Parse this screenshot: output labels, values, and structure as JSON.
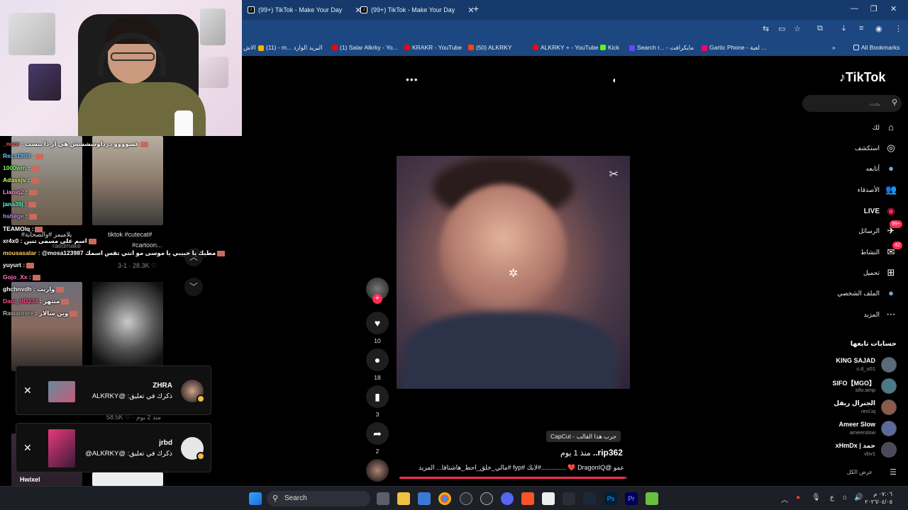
{
  "browser": {
    "tabs": [
      {
        "label": "(99+) TikTok - Make Your Day"
      },
      {
        "label": "(99+) TikTok - Make Your Day"
      }
    ],
    "bookmarks": [
      {
        "label": "الاش",
        "color": "#d9d9d9"
      },
      {
        "label": "(11) - m... البريد الوارد",
        "color": "#f4b400"
      },
      {
        "label": "(1) Salar Alkrky - Yo...",
        "color": "#ff0000"
      },
      {
        "label": "KRAKR - YouTube",
        "color": "#ff0000"
      },
      {
        "label": "(50) ALKRKY",
        "color": "#ff4500"
      },
      {
        "label": "ALKRKY + - YouTube",
        "color": "#ff0000"
      },
      {
        "label": "Kick",
        "color": "#53fc18"
      },
      {
        "label": "Search r... - مايكرافت",
        "color": "#6e44ff"
      },
      {
        "label": "Gartic Phone - لعبة ...",
        "color": "#f06"
      }
    ],
    "all_bookmarks": "All Bookmarks"
  },
  "left_panel": {
    "thumbs": [
      {
        "caption": "#يلاميمز #والصحابة",
        "stat": "raedmake"
      },
      {
        "caption": "tiktok #cutecat#",
        "caption2": "#cartoon...",
        "stat": "3-1 · 28.3K ♡"
      },
      {
        "caption": "",
        "stat": "58.5K ♡ · منذ 2 يوم"
      }
    ],
    "chat": [
      {
        "user": "_noor",
        "text": ": عسوووو درداوشششش هي از ذا بيست",
        "color": "#ff4f4f"
      },
      {
        "user": "Reza1999",
        "text": ":",
        "color": "#6ec6ff"
      },
      {
        "user": "1000wm",
        "text": ":",
        "color": "#7cff6e"
      },
      {
        "user": "Adassjv",
        "text": ":",
        "color": "#d0ff5a"
      },
      {
        "user": "Lianiq2",
        "text": ":",
        "color": "#ff8ad8"
      },
      {
        "user": "jana39j",
        "text": ":",
        "color": "#5affd4"
      },
      {
        "user": "hshege",
        "text": ":",
        "color": "#b98aff"
      },
      {
        "user": "TEAMOlq",
        "text": ":",
        "color": "#ffffff"
      },
      {
        "user": "xr4x0",
        "text": ": اسم على مسمى تنين",
        "color": "#ffffff"
      },
      {
        "user": "mousasalar",
        "text": ": @mosa123987 مطيك يا حبيبي يا موسى مو انتي تقس اسمك",
        "color": "#ffd15a"
      },
      {
        "user": "yuyurt",
        "text": ":",
        "color": "#ffffff"
      },
      {
        "user": "Gojo_Xx",
        "text": ":",
        "color": "#ff6ec7"
      },
      {
        "user": "ghchnvdh",
        "text": ": واربت",
        "color": "#ffffff"
      },
      {
        "user": "Dani_HD234",
        "text": ": منتهر",
        "color": "#ff4f8a"
      },
      {
        "user": "Rawanrere",
        "text": ": وين سالار",
        "color": "#aaaaaa"
      }
    ],
    "notifications": [
      {
        "user": "ZHRA",
        "message": "ذكرك في تعليق: @ALKRKY"
      },
      {
        "user": "jrbd",
        "message": "ذكرك في تعليق: @ALKRKY@"
      }
    ],
    "bottom_label": "Hwixel"
  },
  "video": {
    "likes": "10",
    "comments": "18",
    "saves": "3",
    "shares": "2",
    "template_pill": "CapCut - جرب هذا القالب",
    "author_name": "rip362..",
    "author_time": "منذ 1 يوم",
    "caption": "عمو @DragonIQ ❤️ ..............#لايك #fyp #مالي_خلق_احط_هاشتاقا... المزيد",
    "progress": 0.99
  },
  "tiktok": {
    "logo": "TikTok",
    "search_placeholder": "بحث",
    "nav": [
      {
        "label": "لك",
        "icon": "home-icon",
        "glyph": "⌂"
      },
      {
        "label": "استكشف",
        "icon": "compass-icon",
        "glyph": "◎"
      },
      {
        "label": "أتابعه",
        "icon": "following-avatar-icon",
        "glyph": "●"
      },
      {
        "label": "الأصدقاء",
        "icon": "friends-icon",
        "glyph": "👥"
      },
      {
        "label": "LIVE",
        "icon": "live-icon",
        "glyph": "◉"
      },
      {
        "label": "الرسائل",
        "icon": "messages-icon",
        "glyph": "✈",
        "badge": "99+"
      },
      {
        "label": "النشاط",
        "icon": "activity-icon",
        "glyph": "✉",
        "badge": "42"
      },
      {
        "label": "تحميل",
        "icon": "upload-icon",
        "glyph": "⊞"
      },
      {
        "label": "الملف الشخصي",
        "icon": "profile-avatar-icon",
        "glyph": "●"
      },
      {
        "label": "المزيد",
        "icon": "more-icon",
        "glyph": "⋯"
      }
    ],
    "following_title": "حسابات تابعها",
    "following": [
      {
        "name": "KING SAJAD",
        "handle": "s.d_u01"
      },
      {
        "name": "SIFO【MGO】",
        "handle": "sifo.amp"
      },
      {
        "name": "الجنرال ريفل",
        "handle": "revl.iq"
      },
      {
        "name": "Ameer Slow",
        "handle": "ameerslow"
      },
      {
        "name": "xHmDx | حمد",
        "handle": "vbv1"
      }
    ],
    "see_all": "عرض الكل"
  },
  "taskbar": {
    "search_label": "Search",
    "time": "٠٧:٠٦ م",
    "date": "٢٠٢٦/٠٤/٠٥",
    "lang": "ع"
  }
}
